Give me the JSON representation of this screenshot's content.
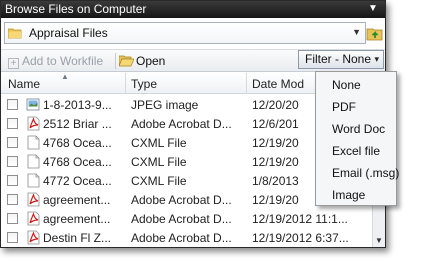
{
  "window": {
    "title": "Browse Files on Computer",
    "menu_icon": "triangle-down-icon"
  },
  "pathbar": {
    "current_folder": "Appraisal Files",
    "folder_icon": "folder-icon",
    "up_icon": "folder-up-icon"
  },
  "toolbar": {
    "add_label": "Add to Workfile",
    "open_label": "Open",
    "filter_label": "Filter - None",
    "filter_arrow": "▾"
  },
  "grid": {
    "columns": [
      "Name",
      "Type",
      "Date Mod"
    ],
    "rows": [
      {
        "icon": "image-icon",
        "name": "1-8-2013-9...",
        "type": "JPEG image",
        "date": "12/20/20"
      },
      {
        "icon": "pdf-icon",
        "name": "2512 Briar ...",
        "type": "Adobe Acrobat D...",
        "date": "12/6/201"
      },
      {
        "icon": "file-icon",
        "name": "4768 Ocea...",
        "type": "CXML File",
        "date": "12/19/20"
      },
      {
        "icon": "file-icon",
        "name": "4768 Ocea...",
        "type": "CXML File",
        "date": "12/19/20"
      },
      {
        "icon": "file-icon",
        "name": "4772 Ocea...",
        "type": "CXML File",
        "date": "1/8/2013"
      },
      {
        "icon": "pdf-icon",
        "name": "agreement...",
        "type": "Adobe Acrobat D...",
        "date": "12/19/20"
      },
      {
        "icon": "pdf-icon",
        "name": "agreement...",
        "type": "Adobe Acrobat D...",
        "date": "12/19/2012 11:1..."
      },
      {
        "icon": "pdf-icon",
        "name": "Destin Fl Z...",
        "type": "Adobe Acrobat D...",
        "date": "12/19/2012 6:37..."
      }
    ]
  },
  "filter_menu": {
    "items": [
      "None",
      "PDF",
      "Word Doc",
      "Excel file",
      "Email (.msg)",
      "Image"
    ]
  }
}
